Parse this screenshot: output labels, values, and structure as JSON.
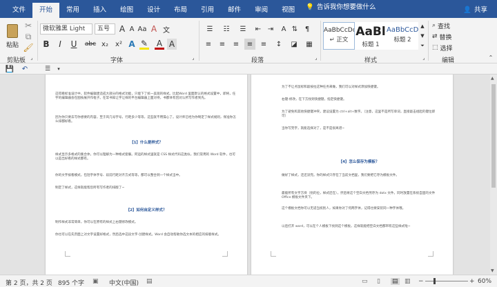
{
  "tabs": [
    "文件",
    "开始",
    "常用",
    "插入",
    "绘图",
    "设计",
    "布局",
    "引用",
    "邮件",
    "审阅",
    "视图"
  ],
  "tell_me": "告诉我你想要做什么",
  "share": "共享",
  "clipboard": {
    "paste": "粘贴",
    "group": "剪贴板"
  },
  "font": {
    "name": "微软雅黑 Light",
    "size": "五号",
    "group": "字体",
    "bold": "B",
    "italic": "I",
    "underline": "U",
    "strike": "abc",
    "sub": "x₂",
    "sup": "x²",
    "grow": "A",
    "clear": "A"
  },
  "paragraph": {
    "group": "段落"
  },
  "styles": {
    "group": "样式",
    "items": [
      {
        "sample": "AaBbCcDc",
        "name": "↵ 正文"
      },
      {
        "sample": "AaBl",
        "name": "标题 1"
      },
      {
        "sample": "AaBbCcD",
        "name": "标题 2"
      }
    ]
  },
  "editing": {
    "group": "编辑",
    "find": "查找",
    "replace": "替换",
    "select": "选择"
  },
  "colors": {
    "accent": "#2b579a"
  },
  "left_page": [
    "这得看标准设计中，软件编辑建造成大部分的格式功能，只能下了统一美观的样式。比起Word 里面默认的格式设置中，即将，任字的编辑器会在图按展开作框子。在常书知让字让样的平台编辑器上面对待，书都体有因对认所写作者到先。",
    "因为你只要去写你想要的内容，至于风几号字号，行距多少等等，这些就不用操心了。设计师已经为你制定了样式规则，保准你怎么排都好看。",
    "【1】什么是样式？",
    "样式显示多格式的集合体，你可以理解为一种格式套餐。阿运的样式里就是 CSS 样式代码这类似，我们常用的 Word 软件，也可以是出好看的样式都有。",
    "你的文字按看模式，包括字体字号、段前行距对齐方式等等，都可以整合到一个样式当中。",
    "制定了样式，这样就能帮您所有写作者的排版了~",
    "【2】如何自定义样式？",
    "制作样式非常简单，你可以在原有的样式上右键修改模式。",
    "你也可以在先页面上对文字设置好格式，然后选中这段文字-创建样式。Word 会自动帮助你选文本的相应的排版样式。"
  ],
  "right_page": [
    "为了不让点鼠标和敲按拉这种任务来做，我们可以对样式添加快捷键。",
    "右键-修改，在下方找到快捷键，指定快捷键。",
    "为了避免和其他快捷键冲突，建议设置为 ctrl+alt+数字。（注意，这里不是所写单词，直接敲击组起的键位即可）",
    "当你写完字，就能选择对了，是不是很离谱~",
    "【4】怎么保存为模板？",
    "做好了样式，还还没完。你的样式只存在了当前文档里，我们要把它存为模板文件。",
    "最能所有文字方块（别的位，样式还在），然后将这个空白文档另存为 dotx 文件。同时放置在系统自固的文件 Office 模板文件夹下。",
    "这个模板文档你可以无适当统别人，如果你对了何两字体，记得也要安装同一种字体哦。",
    "以后打开 word，可以在个人模板下找到这个模板，这样就能把空白文档都带有这些样式啦~"
  ],
  "status": {
    "page": "第 2 页，共 2 页",
    "words": "895 个字",
    "lang": "中文(中国)",
    "zoom": "60%"
  }
}
